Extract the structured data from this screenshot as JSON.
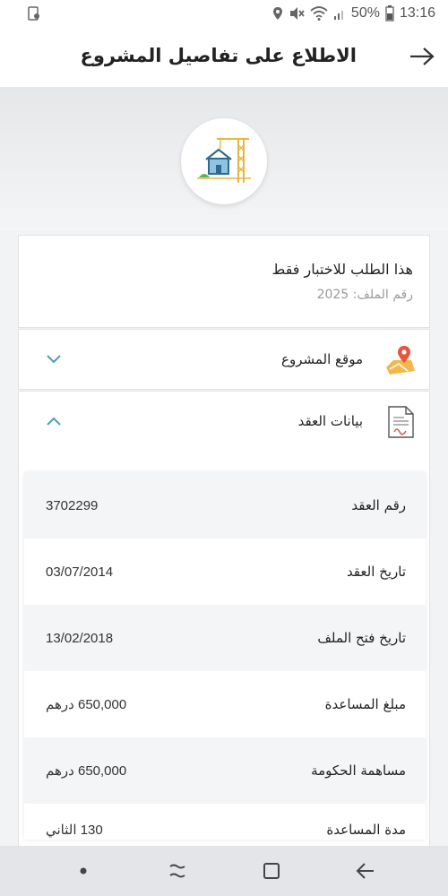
{
  "status_bar": {
    "battery": "50%",
    "time": "13:16",
    "icons": [
      "sim-icon",
      "location-icon",
      "mute-icon",
      "wifi-icon",
      "signal-icon",
      "battery-icon"
    ]
  },
  "header": {
    "title": "الاطلاع على تفاصيل المشروع",
    "back_icon": "arrow-right-icon"
  },
  "summary": {
    "request_title": "هذا الطلب للاختبار فقط",
    "file_label": "رقم الملف:",
    "file_number": "2025"
  },
  "location_section": {
    "label": "موقع المشروع",
    "icon": "map-pin-icon",
    "expanded": false
  },
  "contract_section": {
    "label": "بيانات العقد",
    "icon": "contract-document-icon",
    "expanded": true,
    "rows": [
      {
        "label": "رقم العقد",
        "value": "3702299"
      },
      {
        "label": "تاريخ العقد",
        "value": "03/07/2014"
      },
      {
        "label": "تاريخ فتح الملف",
        "value": "13/02/2018"
      },
      {
        "label": "مبلغ المساعدة",
        "value": "650,000 درهم"
      },
      {
        "label": "مساهمة الحكومة",
        "value": "650,000 درهم"
      },
      {
        "label": "مدة المساعدة",
        "value": "130 الثاني"
      }
    ]
  },
  "colors": {
    "accent": "#4a9fb5",
    "header_bg": "#ffffff",
    "row_alt": "#f4f5f7",
    "nav_bar": "#e4e5e8"
  },
  "nav_bar": {
    "buttons": [
      "dot-icon",
      "recent-apps-icon",
      "home-icon",
      "back-icon"
    ]
  }
}
